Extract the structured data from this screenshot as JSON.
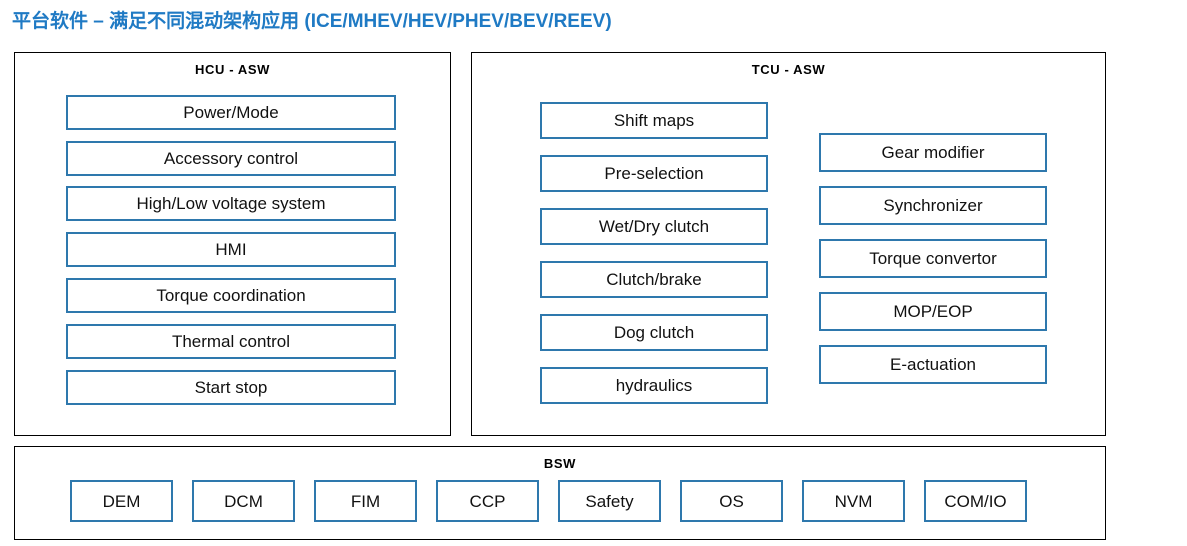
{
  "title": {
    "cjk": "平台软件 – 满足不同混动架构应用",
    "latin": "(ICE/MHEV/HEV/PHEV/BEV/REEV)",
    "color": "#1f7ac4"
  },
  "colors": {
    "box_border": "#2e78ad",
    "panel_border": "#000000",
    "title_blue": "#1f7ac4",
    "text": "#111111",
    "background": "#ffffff"
  },
  "panels": {
    "hcu": {
      "header": "HCU  -  ASW",
      "items": [
        {
          "label": "Power/Mode"
        },
        {
          "label": "Accessory control"
        },
        {
          "label": "High/Low voltage system"
        },
        {
          "label": "HMI"
        },
        {
          "label": "Torque coordination"
        },
        {
          "label": "Thermal control"
        },
        {
          "label": "Start stop"
        }
      ]
    },
    "tcu": {
      "header": "TCU  -  ASW",
      "left_items": [
        {
          "label": "Shift maps"
        },
        {
          "label": "Pre-selection"
        },
        {
          "label": "Wet/Dry clutch"
        },
        {
          "label": "Clutch/brake"
        },
        {
          "label": "Dog clutch"
        },
        {
          "label": "hydraulics"
        }
      ],
      "right_items": [
        {
          "label": "Gear modifier"
        },
        {
          "label": "Synchronizer"
        },
        {
          "label": "Torque convertor"
        },
        {
          "label": "MOP/EOP"
        },
        {
          "label": "E-actuation"
        }
      ]
    },
    "bsw": {
      "header": "BSW",
      "items": [
        {
          "label": "DEM"
        },
        {
          "label": "DCM"
        },
        {
          "label": "FIM"
        },
        {
          "label": "CCP"
        },
        {
          "label": "Safety"
        },
        {
          "label": "OS"
        },
        {
          "label": "NVM"
        },
        {
          "label": "COM/IO"
        }
      ]
    }
  }
}
